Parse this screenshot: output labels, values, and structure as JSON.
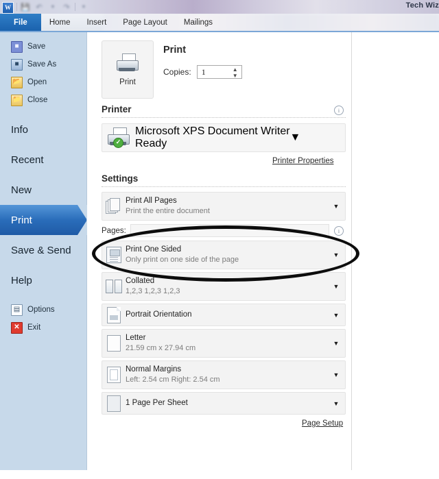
{
  "window": {
    "title": "Tech Wiz",
    "quick_access": [
      "word-logo",
      "save-icon",
      "undo-icon",
      "redo-icon",
      "customize-icon"
    ]
  },
  "ribbon": {
    "tabs": [
      {
        "label": "File",
        "active": true
      },
      {
        "label": "Home",
        "active": false
      },
      {
        "label": "Insert",
        "active": false
      },
      {
        "label": "Page Layout",
        "active": false
      },
      {
        "label": "Mailings",
        "active": false
      }
    ]
  },
  "sidebar": {
    "small_items": [
      {
        "label": "Save",
        "icon": "save-icon"
      },
      {
        "label": "Save As",
        "icon": "save-as-icon"
      },
      {
        "label": "Open",
        "icon": "open-folder-icon"
      },
      {
        "label": "Close",
        "icon": "close-folder-icon"
      }
    ],
    "big_items": [
      {
        "label": "Info",
        "active": false
      },
      {
        "label": "Recent",
        "active": false
      },
      {
        "label": "New",
        "active": false
      },
      {
        "label": "Print",
        "active": true
      },
      {
        "label": "Save & Send",
        "active": false
      },
      {
        "label": "Help",
        "active": false
      }
    ],
    "bottom_items": [
      {
        "label": "Options",
        "icon": "options-icon"
      },
      {
        "label": "Exit",
        "icon": "exit-icon"
      }
    ]
  },
  "print_pane": {
    "print_button_label": "Print",
    "heading": "Print",
    "copies_label": "Copies:",
    "copies_value": "1",
    "printer_section": {
      "heading": "Printer",
      "name": "Microsoft XPS Document Writer",
      "status": "Ready",
      "properties_link": "Printer Properties"
    },
    "settings_section": {
      "heading": "Settings",
      "rows": [
        {
          "title": "Print All Pages",
          "subtitle": "Print the entire document",
          "icon": "pages-stack-icon"
        },
        {
          "title": "Print One Sided",
          "subtitle": "Only print on one side of the page",
          "icon": "one-sided-icon"
        },
        {
          "title": "Collated",
          "subtitle": "1,2,3   1,2,3   1,2,3",
          "icon": "collate-icon"
        },
        {
          "title": "Portrait Orientation",
          "subtitle": "",
          "icon": "portrait-icon"
        },
        {
          "title": "Letter",
          "subtitle": "21.59 cm x 27.94 cm",
          "icon": "paper-size-icon"
        },
        {
          "title": "Normal Margins",
          "subtitle": "Left:  2.54 cm    Right:  2.54 cm",
          "icon": "margins-icon"
        },
        {
          "title": "1 Page Per Sheet",
          "subtitle": "",
          "icon": "pages-per-sheet-icon"
        }
      ],
      "pages_label": "Pages:",
      "pages_value": "",
      "page_setup_link": "Page Setup"
    }
  },
  "annotation": {
    "shape": "ellipse",
    "color": "#0d0d0d",
    "target": "Print One Sided"
  },
  "colors": {
    "accent_blue": "#1f5aa6",
    "sidebar_blue": "#c7d9ea",
    "ribbon_rule": "#7ba7d7",
    "ready_green": "#4fae3f"
  }
}
